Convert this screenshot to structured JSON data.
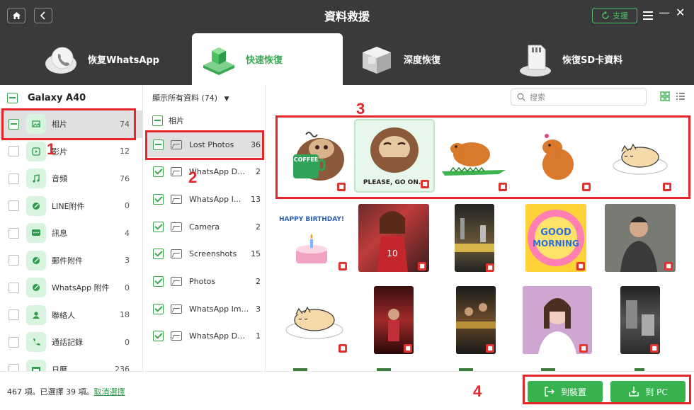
{
  "window": {
    "title": "資料救援",
    "support_label": "支援",
    "minimize": "—",
    "close": "✕"
  },
  "tabs": [
    {
      "label": "恢复WhatsApp",
      "icon": "whatsapp-cloud-icon",
      "active": false
    },
    {
      "label": "快速恢復",
      "icon": "quick-recovery-cube-icon",
      "active": true
    },
    {
      "label": "深度恢復",
      "icon": "deep-recovery-box-icon",
      "active": false
    },
    {
      "label": "恢復SD卡資料",
      "icon": "sd-card-icon",
      "active": false
    }
  ],
  "sidebar": {
    "device": "Galaxy A40",
    "items": [
      {
        "label": "相片",
        "count": "74",
        "icon": "photo-icon",
        "selected": true
      },
      {
        "label": "影片",
        "count": "12",
        "icon": "video-icon",
        "selected": false
      },
      {
        "label": "音頻",
        "count": "76",
        "icon": "music-icon",
        "selected": false
      },
      {
        "label": "LINE附件",
        "count": "0",
        "icon": "line-attachment-icon",
        "selected": false
      },
      {
        "label": "訊息",
        "count": "4",
        "icon": "message-icon",
        "selected": false
      },
      {
        "label": "郵件附件",
        "count": "3",
        "icon": "mail-attachment-icon",
        "selected": false
      },
      {
        "label": "WhatsApp 附件",
        "count": "0",
        "icon": "whatsapp-attachment-icon",
        "selected": false
      },
      {
        "label": "聯絡人",
        "count": "18",
        "icon": "contacts-icon",
        "selected": false
      },
      {
        "label": "通話記錄",
        "count": "0",
        "icon": "call-log-icon",
        "selected": false
      },
      {
        "label": "日曆",
        "count": "236",
        "icon": "calendar-icon",
        "selected": false
      }
    ]
  },
  "folders": {
    "filter_label": "顯示所有資料 (74)",
    "header": "相片",
    "items": [
      {
        "name": "Lost Photos",
        "count": "36",
        "selected": true
      },
      {
        "name": "WhatsApp Do...",
        "count": "2",
        "selected": false
      },
      {
        "name": "WhatsApp I...",
        "count": "13",
        "selected": false
      },
      {
        "name": "Camera",
        "count": "2",
        "selected": false
      },
      {
        "name": "Screenshots",
        "count": "15",
        "selected": false
      },
      {
        "name": "Photos",
        "count": "2",
        "selected": false
      },
      {
        "name": "WhatsApp Im...",
        "count": "3",
        "selected": false
      },
      {
        "name": "WhatsApp Do...",
        "count": "1",
        "selected": false
      }
    ]
  },
  "gallery": {
    "search_placeholder": "搜索",
    "sticker_texts": {
      "coffee": "COFFEE",
      "please": "PLEASE, GO ON...",
      "birthday": "HAPPY BIRTHDAY!",
      "good": "GOOD",
      "morning": "MORNING"
    }
  },
  "footer": {
    "status_text": "467 項。已選擇 39 項。",
    "deselect_link": "取消選擇",
    "to_device_label": "到裝置",
    "to_pc_label": "到 PC"
  },
  "annotations": [
    "1",
    "2",
    "3",
    "4"
  ],
  "colors": {
    "accent": "#36b24e",
    "annotation": "#e4252a",
    "titlebar": "#3a3a3a"
  }
}
